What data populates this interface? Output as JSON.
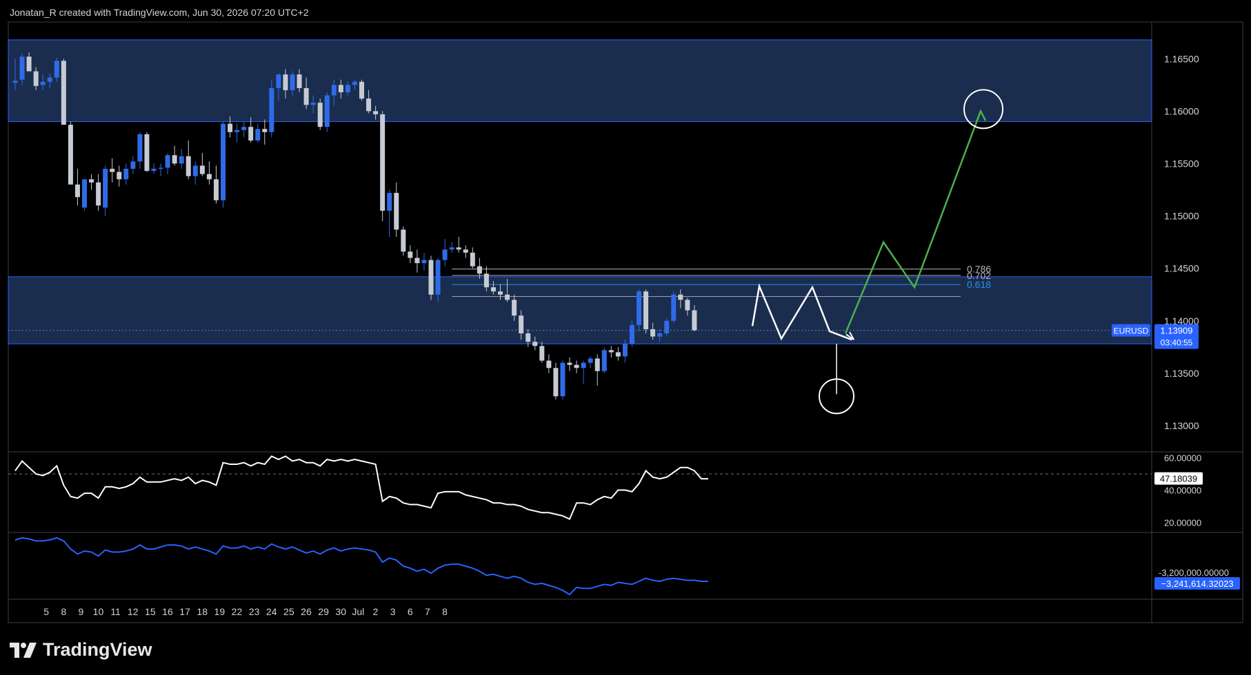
{
  "header": {
    "attribution": "Jonatan_R created with TradingView.com, Jun 30, 2026 07:20 UTC+2"
  },
  "brand": {
    "name": "TradingView",
    "icon": "tradingview-logo-icon"
  },
  "colors": {
    "background": "#000000",
    "up_candle": "#2f6be8",
    "down_candle": "#c6cad3",
    "zone_fill": "#1b2d4e",
    "zone_border": "#2962ff",
    "projection": "#4caf50",
    "pattern": "#ffffff",
    "rsi_line": "#ffffff",
    "obv_line": "#2962ff",
    "label_bg": "#2962ff"
  },
  "price_axis": {
    "ticks": [
      "1.16500",
      "1.16000",
      "1.15500",
      "1.15000",
      "1.14500",
      "1.14000",
      "1.13500",
      "1.13000"
    ]
  },
  "time_axis": {
    "ticks": [
      "5",
      "8",
      "9",
      "10",
      "11",
      "12",
      "15",
      "16",
      "17",
      "18",
      "19",
      "22",
      "23",
      "24",
      "25",
      "26",
      "29",
      "30",
      "Jul",
      "2",
      "3",
      "6",
      "7",
      "8"
    ]
  },
  "symbol_label": {
    "symbol": "EURUSD",
    "price": "1.13909",
    "countdown": "03:40:55"
  },
  "fib_levels": [
    {
      "label": "0.786",
      "price": 1.14494,
      "color": "#b2b5be"
    },
    {
      "label": "0.702",
      "price": 1.14433,
      "color": "#b2b5be"
    },
    {
      "label": "0.618",
      "price": 1.14346,
      "color": "#2196f3"
    }
  ],
  "zones": [
    {
      "name": "upper-resistance-zone",
      "top": 1.1668,
      "bottom": 1.159
    },
    {
      "name": "demand-zone",
      "top": 1.1442,
      "bottom": 1.1378
    }
  ],
  "rsi_panel": {
    "ticks": [
      "60.00000",
      "40.00000",
      "20.00000"
    ],
    "current_label": "47.18039"
  },
  "obv_panel": {
    "ticks": [
      "-3,200,000.00000"
    ],
    "current_label": "−3,241,614.32023"
  },
  "chart_data": {
    "type": "candlestick",
    "symbol": "EURUSD",
    "ylim": [
      1.1275,
      1.1685
    ],
    "timeline": [
      {
        "label": "5",
        "index": 2
      },
      {
        "label": "8",
        "index": 4.5
      },
      {
        "label": "9",
        "index": 7
      },
      {
        "label": "10",
        "index": 9.5
      },
      {
        "label": "11",
        "index": 12
      },
      {
        "label": "12",
        "index": 14.5
      },
      {
        "label": "15",
        "index": 17
      },
      {
        "label": "16",
        "index": 19.5
      },
      {
        "label": "17",
        "index": 22
      },
      {
        "label": "18",
        "index": 24.5
      },
      {
        "label": "19",
        "index": 27
      },
      {
        "label": "22",
        "index": 29.5
      },
      {
        "label": "23",
        "index": 32
      },
      {
        "label": "24",
        "index": 34.5
      },
      {
        "label": "25",
        "index": 37
      },
      {
        "label": "26",
        "index": 39.5
      },
      {
        "label": "29",
        "index": 42
      },
      {
        "label": "30",
        "index": 44.5
      },
      {
        "label": "Jul",
        "index": 47
      },
      {
        "label": "2",
        "index": 49.5
      },
      {
        "label": "3",
        "index": 52
      },
      {
        "label": "6",
        "index": 54.5
      },
      {
        "label": "7",
        "index": 57
      },
      {
        "label": "8",
        "index": 59.5
      }
    ],
    "ohlc": [
      [
        1.1627,
        1.165,
        1.162,
        1.1629
      ],
      [
        1.163,
        1.1655,
        1.1625,
        1.1652
      ],
      [
        1.1652,
        1.1656,
        1.1638,
        1.1638
      ],
      [
        1.1638,
        1.1642,
        1.162,
        1.1624
      ],
      [
        1.1625,
        1.1635,
        1.162,
        1.1628
      ],
      [
        1.1628,
        1.1636,
        1.1622,
        1.1632
      ],
      [
        1.1632,
        1.1651,
        1.1628,
        1.1648
      ],
      [
        1.1648,
        1.165,
        1.1587,
        1.1587
      ],
      [
        1.1587,
        1.159,
        1.153,
        1.153
      ],
      [
        1.153,
        1.1545,
        1.151,
        1.1518
      ],
      [
        1.1508,
        1.1535,
        1.1505,
        1.1535
      ],
      [
        1.1535,
        1.154,
        1.1525,
        1.1532
      ],
      [
        1.1532,
        1.154,
        1.1505,
        1.151
      ],
      [
        1.1508,
        1.1548,
        1.15,
        1.1545
      ],
      [
        1.1545,
        1.1555,
        1.1532,
        1.1542
      ],
      [
        1.1542,
        1.1548,
        1.1528,
        1.1535
      ],
      [
        1.1535,
        1.155,
        1.153,
        1.1545
      ],
      [
        1.1545,
        1.1557,
        1.154,
        1.1552
      ],
      [
        1.1552,
        1.158,
        1.1545,
        1.1578
      ],
      [
        1.1578,
        1.158,
        1.1542,
        1.1543
      ],
      [
        1.1543,
        1.155,
        1.154,
        1.1545
      ],
      [
        1.1545,
        1.155,
        1.1538,
        1.1546
      ],
      [
        1.1546,
        1.156,
        1.154,
        1.1558
      ],
      [
        1.1558,
        1.1567,
        1.1548,
        1.155
      ],
      [
        1.155,
        1.1564,
        1.1545,
        1.1557
      ],
      [
        1.1557,
        1.1572,
        1.1535,
        1.1538
      ],
      [
        1.1538,
        1.1552,
        1.153,
        1.1548
      ],
      [
        1.1548,
        1.156,
        1.1538,
        1.154
      ],
      [
        1.154,
        1.1552,
        1.153,
        1.1535
      ],
      [
        1.1535,
        1.1548,
        1.1512,
        1.1515
      ],
      [
        1.1515,
        1.159,
        1.1508,
        1.1588
      ],
      [
        1.1588,
        1.1595,
        1.1575,
        1.158
      ],
      [
        1.158,
        1.1588,
        1.157,
        1.1582
      ],
      [
        1.1582,
        1.159,
        1.1575,
        1.1585
      ],
      [
        1.1585,
        1.1594,
        1.157,
        1.1572
      ],
      [
        1.1572,
        1.1588,
        1.157,
        1.1583
      ],
      [
        1.1583,
        1.1592,
        1.1568,
        1.158
      ],
      [
        1.158,
        1.163,
        1.1575,
        1.1622
      ],
      [
        1.1622,
        1.1636,
        1.161,
        1.1635
      ],
      [
        1.1635,
        1.164,
        1.1612,
        1.162
      ],
      [
        1.162,
        1.1638,
        1.1615,
        1.1635
      ],
      [
        1.1635,
        1.164,
        1.1618,
        1.1622
      ],
      [
        1.1622,
        1.1632,
        1.1602,
        1.1606
      ],
      [
        1.1606,
        1.1615,
        1.1598,
        1.1608
      ],
      [
        1.1608,
        1.1612,
        1.1582,
        1.1585
      ],
      [
        1.1585,
        1.1618,
        1.158,
        1.1615
      ],
      [
        1.1615,
        1.163,
        1.1605,
        1.1625
      ],
      [
        1.1625,
        1.163,
        1.1612,
        1.1618
      ],
      [
        1.1618,
        1.1628,
        1.1615,
        1.1625
      ],
      [
        1.1625,
        1.163,
        1.162,
        1.1628
      ],
      [
        1.1628,
        1.163,
        1.161,
        1.1612
      ],
      [
        1.1612,
        1.162,
        1.1598,
        1.16
      ],
      [
        1.16,
        1.1605,
        1.1592,
        1.1597
      ],
      [
        1.1597,
        1.16,
        1.1495,
        1.1505
      ],
      [
        1.1505,
        1.1525,
        1.148,
        1.1522
      ],
      [
        1.1522,
        1.1532,
        1.148,
        1.1487
      ],
      [
        1.1487,
        1.149,
        1.1462,
        1.1466
      ],
      [
        1.1466,
        1.1472,
        1.1455,
        1.146
      ],
      [
        1.146,
        1.1468,
        1.1446,
        1.1455
      ],
      [
        1.1455,
        1.1465,
        1.1448,
        1.1458
      ],
      [
        1.1458,
        1.1462,
        1.142,
        1.1425
      ],
      [
        1.1425,
        1.146,
        1.1418,
        1.1458
      ],
      [
        1.1458,
        1.1478,
        1.1452,
        1.1468
      ],
      [
        1.1468,
        1.1475,
        1.1465,
        1.147
      ],
      [
        1.147,
        1.148,
        1.1465,
        1.1468
      ],
      [
        1.1468,
        1.1472,
        1.146,
        1.1465
      ],
      [
        1.1465,
        1.147,
        1.145,
        1.1452
      ],
      [
        1.1452,
        1.146,
        1.144,
        1.1445
      ],
      [
        1.1445,
        1.1452,
        1.1428,
        1.1432
      ],
      [
        1.1432,
        1.1438,
        1.1425,
        1.1428
      ],
      [
        1.1428,
        1.1435,
        1.142,
        1.1425
      ],
      [
        1.1425,
        1.144,
        1.1418,
        1.142
      ],
      [
        1.142,
        1.1425,
        1.14,
        1.1405
      ],
      [
        1.1405,
        1.141,
        1.1382,
        1.1388
      ],
      [
        1.1388,
        1.1392,
        1.1375,
        1.138
      ],
      [
        1.138,
        1.1385,
        1.1372,
        1.1376
      ],
      [
        1.1376,
        1.138,
        1.136,
        1.1362
      ],
      [
        1.1362,
        1.1368,
        1.135,
        1.1355
      ],
      [
        1.1355,
        1.136,
        1.1325,
        1.1328
      ],
      [
        1.1328,
        1.1362,
        1.1325,
        1.136
      ],
      [
        1.136,
        1.1365,
        1.1352,
        1.1358
      ],
      [
        1.1358,
        1.1362,
        1.135,
        1.1355
      ],
      [
        1.1355,
        1.1362,
        1.134,
        1.136
      ],
      [
        1.136,
        1.1366,
        1.1355,
        1.1364
      ],
      [
        1.1364,
        1.1368,
        1.1338,
        1.1352
      ],
      [
        1.1352,
        1.1375,
        1.135,
        1.1372
      ],
      [
        1.1372,
        1.1376,
        1.1365,
        1.137
      ],
      [
        1.137,
        1.1375,
        1.1362,
        1.1366
      ],
      [
        1.1366,
        1.1382,
        1.136,
        1.1378
      ],
      [
        1.1378,
        1.14,
        1.1375,
        1.1396
      ],
      [
        1.1396,
        1.143,
        1.139,
        1.1428
      ],
      [
        1.1428,
        1.143,
        1.1388,
        1.1392
      ],
      [
        1.1392,
        1.1398,
        1.1382,
        1.1385
      ],
      [
        1.1385,
        1.1392,
        1.138,
        1.1388
      ],
      [
        1.1388,
        1.1402,
        1.1385,
        1.14
      ],
      [
        1.14,
        1.1428,
        1.1398,
        1.1425
      ],
      [
        1.1425,
        1.143,
        1.1412,
        1.142
      ],
      [
        1.142,
        1.1422,
        1.1405,
        1.141
      ],
      [
        1.141,
        1.1415,
        1.139,
        1.1391
      ]
    ],
    "rsi": {
      "name": "RSI",
      "values": [
        52,
        58,
        54,
        50,
        49,
        51,
        55,
        43,
        36,
        35,
        38,
        38,
        35,
        42,
        42,
        41,
        42,
        44,
        48,
        45,
        45,
        45,
        46,
        47,
        46,
        48,
        44,
        46,
        45,
        43,
        57,
        56,
        56,
        57,
        55,
        57,
        56,
        61,
        59,
        61,
        58,
        59,
        57,
        57,
        55,
        59,
        58,
        59,
        58,
        59,
        58,
        57,
        56,
        33,
        36,
        35,
        32,
        31,
        31,
        30,
        29,
        38,
        39,
        39,
        39,
        37,
        36,
        35,
        34,
        32,
        32,
        31,
        31,
        30,
        28,
        27,
        26,
        26,
        25,
        24,
        22,
        32,
        32,
        31,
        34,
        36,
        35,
        40,
        40,
        39,
        44,
        52,
        48,
        47,
        48,
        51,
        54,
        54,
        52,
        47,
        47
      ],
      "ylim": [
        15,
        62
      ]
    },
    "obv": {
      "name": "OBV",
      "values": [
        0.4,
        0.6,
        0.5,
        0.3,
        0.3,
        0.4,
        0.6,
        0.3,
        -0.5,
        -1.0,
        -0.7,
        -0.8,
        -1.2,
        -0.6,
        -0.8,
        -0.8,
        -0.7,
        -0.5,
        -0.1,
        -0.5,
        -0.5,
        -0.3,
        -0.1,
        -0.1,
        -0.2,
        -0.5,
        -0.3,
        -0.5,
        -0.7,
        -1.0,
        -0.2,
        -0.4,
        -0.4,
        -0.2,
        -0.5,
        -0.3,
        -0.5,
        0.0,
        -0.3,
        -0.5,
        -0.3,
        -0.6,
        -0.9,
        -0.7,
        -1.0,
        -0.6,
        -0.4,
        -0.7,
        -0.5,
        -0.4,
        -0.5,
        -0.6,
        -0.8,
        -1.8,
        -1.4,
        -1.6,
        -2.2,
        -2.4,
        -2.7,
        -2.5,
        -2.9,
        -2.4,
        -2.1,
        -2.0,
        -2.0,
        -2.2,
        -2.4,
        -2.7,
        -3.1,
        -3.0,
        -3.2,
        -3.4,
        -3.2,
        -3.4,
        -3.8,
        -4.0,
        -3.9,
        -4.1,
        -4.3,
        -4.6,
        -5.0,
        -4.3,
        -4.4,
        -4.4,
        -4.2,
        -4.0,
        -4.1,
        -3.8,
        -3.9,
        -4.0,
        -3.7,
        -3.4,
        -3.6,
        -3.7,
        -3.5,
        -3.4,
        -3.5,
        -3.6,
        -3.6,
        -3.7,
        -3.7
      ],
      "ylim": [
        -5.2,
        0.8
      ]
    }
  }
}
